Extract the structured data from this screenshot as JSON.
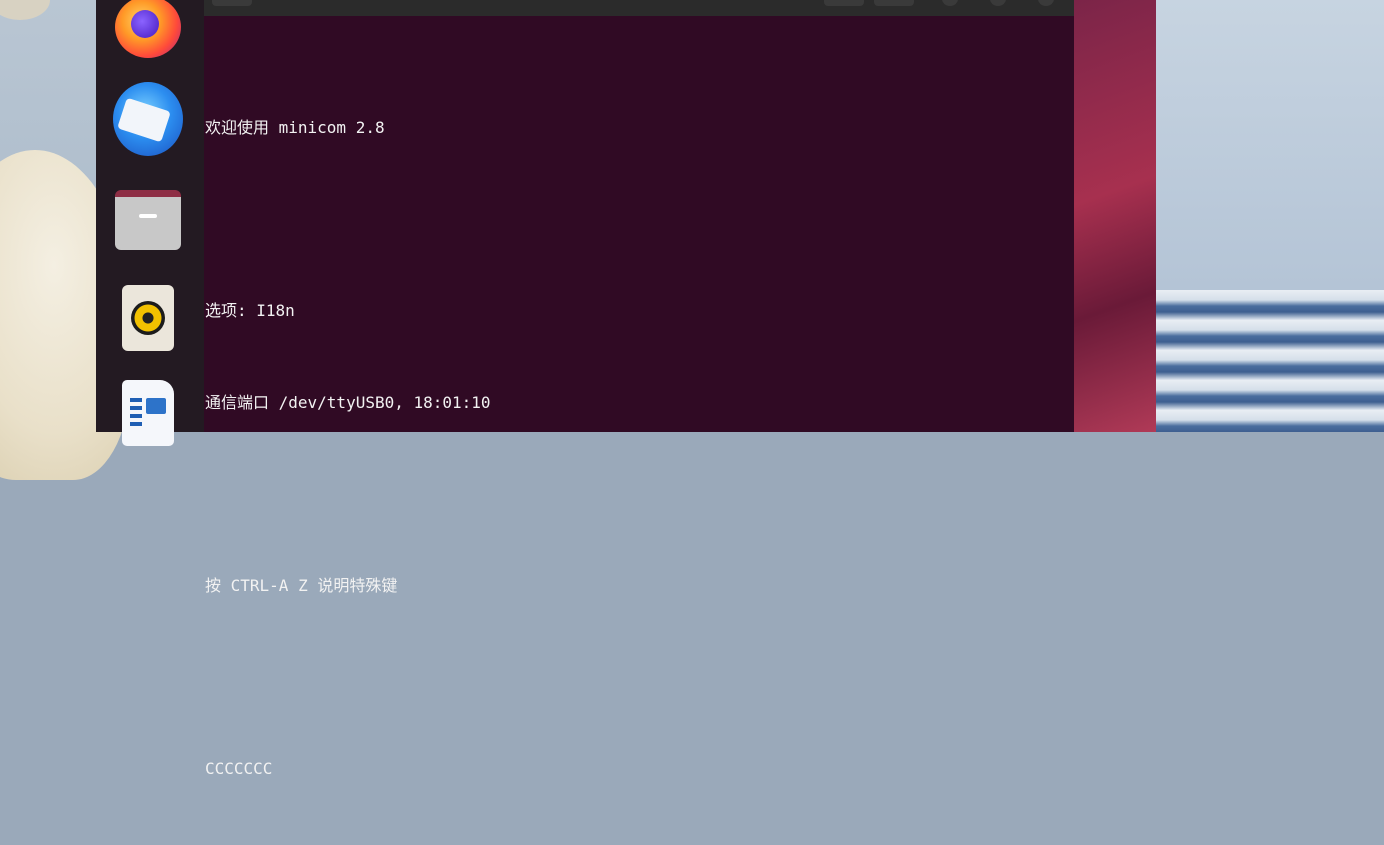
{
  "dock": {
    "items": [
      {
        "name": "Firefox"
      },
      {
        "name": "Thunderbird"
      },
      {
        "name": "Files"
      },
      {
        "name": "Rhythmbox"
      },
      {
        "name": "LibreOffice Writer"
      }
    ]
  },
  "terminal": {
    "lines": [
      "欢迎使用 minicom 2.8",
      "",
      "选项: I18n",
      "通信端口 /dev/ttyUSB0, 18:01:10",
      "",
      "按 CTRL-A Z 说明特殊键",
      "",
      "CCCCCCC"
    ]
  },
  "colors": {
    "terminal_background": "#300a24",
    "dock_background": "#231a22",
    "text": "#f2f2f2"
  }
}
